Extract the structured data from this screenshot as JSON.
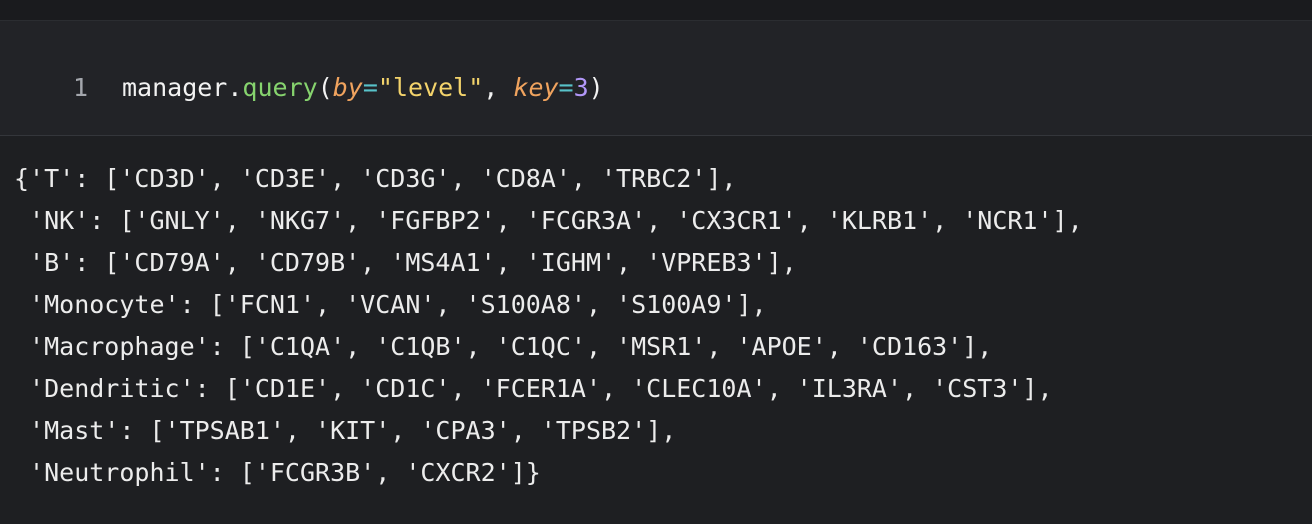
{
  "input_cell": {
    "line_number": "1",
    "code_tokens": [
      {
        "text": "manager",
        "cls": "tok-obj"
      },
      {
        "text": ".",
        "cls": "tok-punc"
      },
      {
        "text": "query",
        "cls": "tok-fn"
      },
      {
        "text": "(",
        "cls": "tok-punc"
      },
      {
        "text": "by",
        "cls": "tok-kw"
      },
      {
        "text": "=",
        "cls": "tok-op"
      },
      {
        "text": "\"level\"",
        "cls": "tok-str"
      },
      {
        "text": ", ",
        "cls": "tok-punc"
      },
      {
        "text": "key",
        "cls": "tok-kw"
      },
      {
        "text": "=",
        "cls": "tok-op"
      },
      {
        "text": "3",
        "cls": "tok-num"
      },
      {
        "text": ")",
        "cls": "tok-punc"
      }
    ]
  },
  "output_cell": {
    "lines": [
      "{'T': ['CD3D', 'CD3E', 'CD3G', 'CD8A', 'TRBC2'],",
      " 'NK': ['GNLY', 'NKG7', 'FGFBP2', 'FCGR3A', 'CX3CR1', 'KLRB1', 'NCR1'],",
      " 'B': ['CD79A', 'CD79B', 'MS4A1', 'IGHM', 'VPREB3'],",
      " 'Monocyte': ['FCN1', 'VCAN', 'S100A8', 'S100A9'],",
      " 'Macrophage': ['C1QA', 'C1QB', 'C1QC', 'MSR1', 'APOE', 'CD163'],",
      " 'Dendritic': ['CD1E', 'CD1C', 'FCER1A', 'CLEC10A', 'IL3RA', 'CST3'],",
      " 'Mast': ['TPSAB1', 'KIT', 'CPA3', 'TPSB2'],",
      " 'Neutrophil': ['FCGR3B', 'CXCR2']}"
    ]
  }
}
